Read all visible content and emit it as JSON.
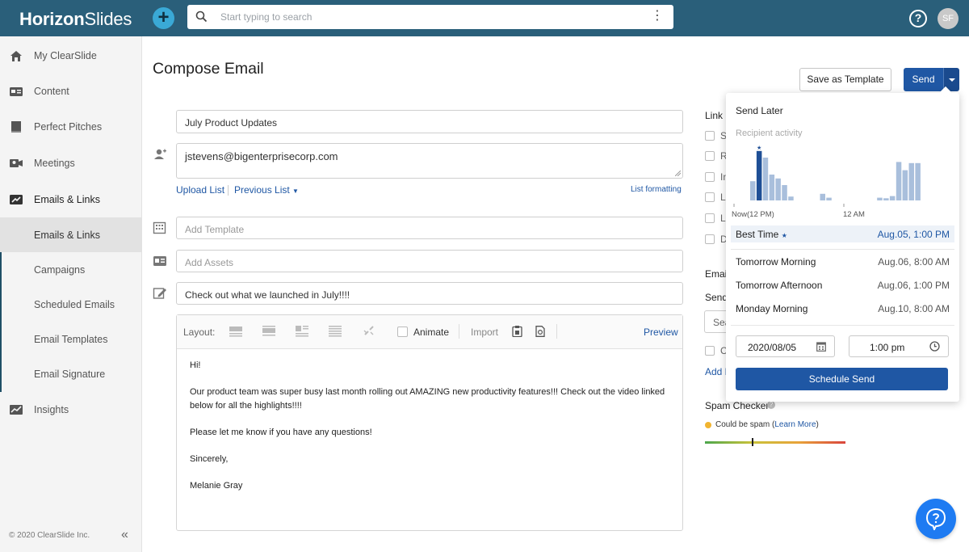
{
  "topbar": {
    "brand_bold": "Horizon",
    "brand_rest": "Slides",
    "search_placeholder": "Start typing to search",
    "avatar_initials": "SF",
    "help_glyph": "?"
  },
  "sidebar": {
    "items": [
      {
        "label": "My ClearSlide",
        "icon": "home-icon"
      },
      {
        "label": "Content",
        "icon": "content-icon"
      },
      {
        "label": "Perfect Pitches",
        "icon": "book-icon"
      },
      {
        "label": "Meetings",
        "icon": "meetings-icon"
      },
      {
        "label": "Emails & Links",
        "icon": "email-links-icon"
      }
    ],
    "subitems": [
      {
        "label": "Emails & Links"
      },
      {
        "label": "Campaigns"
      },
      {
        "label": "Scheduled Emails"
      },
      {
        "label": "Email Templates"
      },
      {
        "label": "Email Signature"
      }
    ],
    "insights": {
      "label": "Insights",
      "icon": "insights-icon"
    },
    "footer": "© 2020 ClearSlide Inc."
  },
  "compose": {
    "title": "Compose Email",
    "save_template": "Save as Template",
    "send": "Send",
    "subject": "July Product Updates",
    "recipient": "jstevens@bigenterprisecorp.com",
    "upload_list": "Upload List",
    "previous_list": "Previous List",
    "list_formatting": "List formatting",
    "template_placeholder": "Add Template",
    "assets_placeholder": "Add Assets",
    "headline": "Check out what we launched in July!!!!",
    "toolbar": {
      "layout": "Layout:",
      "animate": "Animate",
      "import": "Import",
      "preview": "Preview"
    },
    "body": [
      "Hi!",
      "Our product team was super busy last month rolling out AMAZING new productivity features!!! Check out the video linked below for all the highlights!!!!",
      "Please let me know if you have any questions!",
      "Sincerely,",
      "Melanie Gray"
    ]
  },
  "right_col": {
    "link_heading": "Link (",
    "checkbox_letters": [
      "S",
      "R",
      "In",
      "L",
      "L",
      "D"
    ],
    "email_heading": "Emai",
    "send_label": "Send",
    "search_partial": "Sea",
    "cb_partial": "C",
    "add_partial": "Add N",
    "spam_title": "Spam Checker",
    "spam_status": "Could be spam (",
    "spam_learn": "Learn More",
    "spam_close": ")",
    "spam_level": 0.34
  },
  "send_later": {
    "title": "Send Later",
    "subtitle": "Recipient activity",
    "axis_now": "Now(12 PM)",
    "axis_am": "12 AM",
    "activity": [
      0.35,
      0.9,
      0.78,
      0.47,
      0.4,
      0.28,
      0.07,
      0,
      0,
      0,
      0,
      0.12,
      0.05,
      0,
      0,
      0,
      0,
      0,
      0,
      0,
      0.05,
      0.04,
      0.08,
      0.7,
      0.55,
      0.68,
      0.68
    ],
    "best_index": 1,
    "best_time_label": "Best Time",
    "best_time_value": "Aug.05, 1:00 PM",
    "options": [
      {
        "label": "Tomorrow Morning",
        "value": "Aug.06, 8:00 AM"
      },
      {
        "label": "Tomorrow Afternoon",
        "value": "Aug.06, 1:00 PM"
      },
      {
        "label": "Monday Morning",
        "value": "Aug.10, 8:00 AM"
      }
    ],
    "date": "2020/08/05",
    "time": "1:00 pm",
    "schedule_button": "Schedule Send"
  },
  "colors": {
    "topbar": "#2a5f7a",
    "accent": "#1f57a4",
    "bar_light": "#a9bfdc",
    "bar_best": "#1f4f96",
    "fab": "#1e7bf2"
  }
}
